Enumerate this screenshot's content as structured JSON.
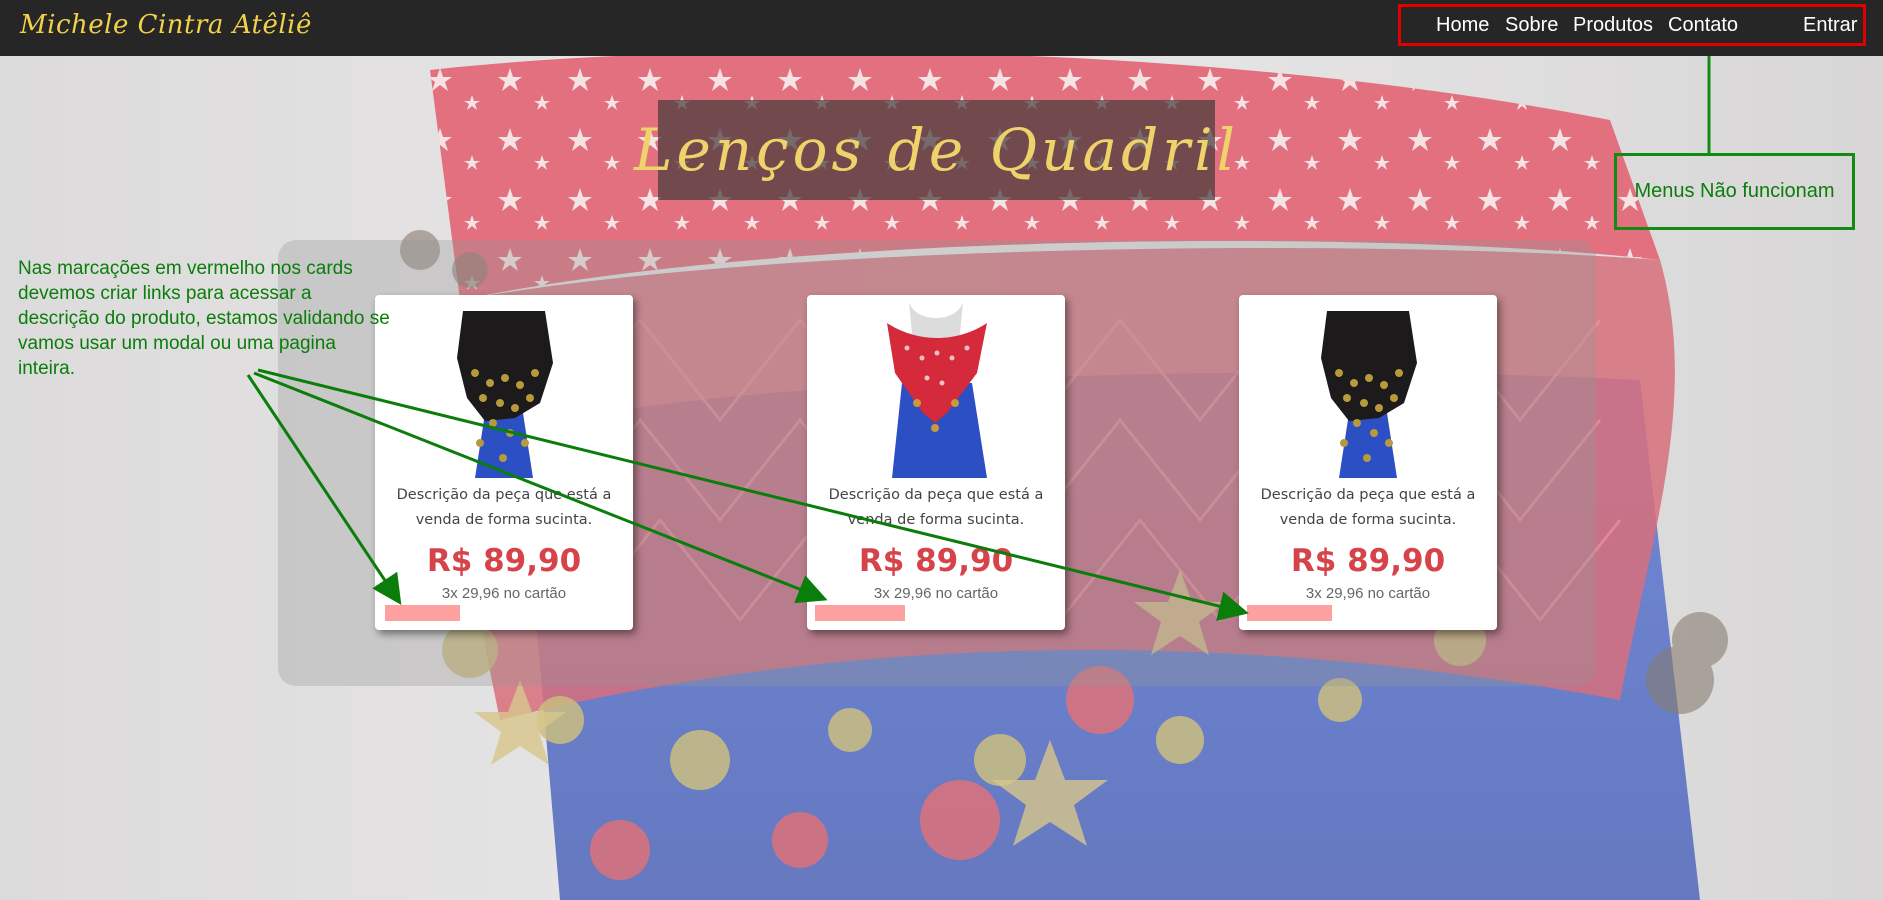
{
  "brand": "Michele Cintra Atêliê",
  "nav": {
    "items": [
      "Home",
      "Sobre",
      "Produtos",
      "Contato"
    ],
    "login": "Entrar"
  },
  "page_title": "Lenços de Quadril",
  "products": [
    {
      "description": "Descrição da peça que está a venda de forma sucinta.",
      "price": "R$ 89,90",
      "installments": "3x 29,96 no cartão",
      "image": "black-coin-hip-scarf"
    },
    {
      "description": "Descrição da peça que está a venda de forma sucinta.",
      "price": "R$ 89,90",
      "installments": "3x 29,96 no cartão",
      "image": "red-crochet-hip-scarf"
    },
    {
      "description": "Descrição da peça que está a venda de forma sucinta.",
      "price": "R$ 89,90",
      "installments": "3x 29,96 no cartão",
      "image": "black-coin-hip-scarf"
    }
  ],
  "annotations": {
    "cards_note": "Nas marcações em vermelho nos cards devemos criar links para acessar a descrição do produto, estamos validando se vamos usar um modal ou uma pagina inteira.",
    "menu_note": "Menus Não funcionam"
  },
  "colors": {
    "navbar": "#262626",
    "brand": "#f2d14a",
    "price": "#d6434a",
    "annotation_green": "#0a7d0a",
    "annotation_red": "#e10000",
    "link_placeholder": "#ffa0a0"
  }
}
